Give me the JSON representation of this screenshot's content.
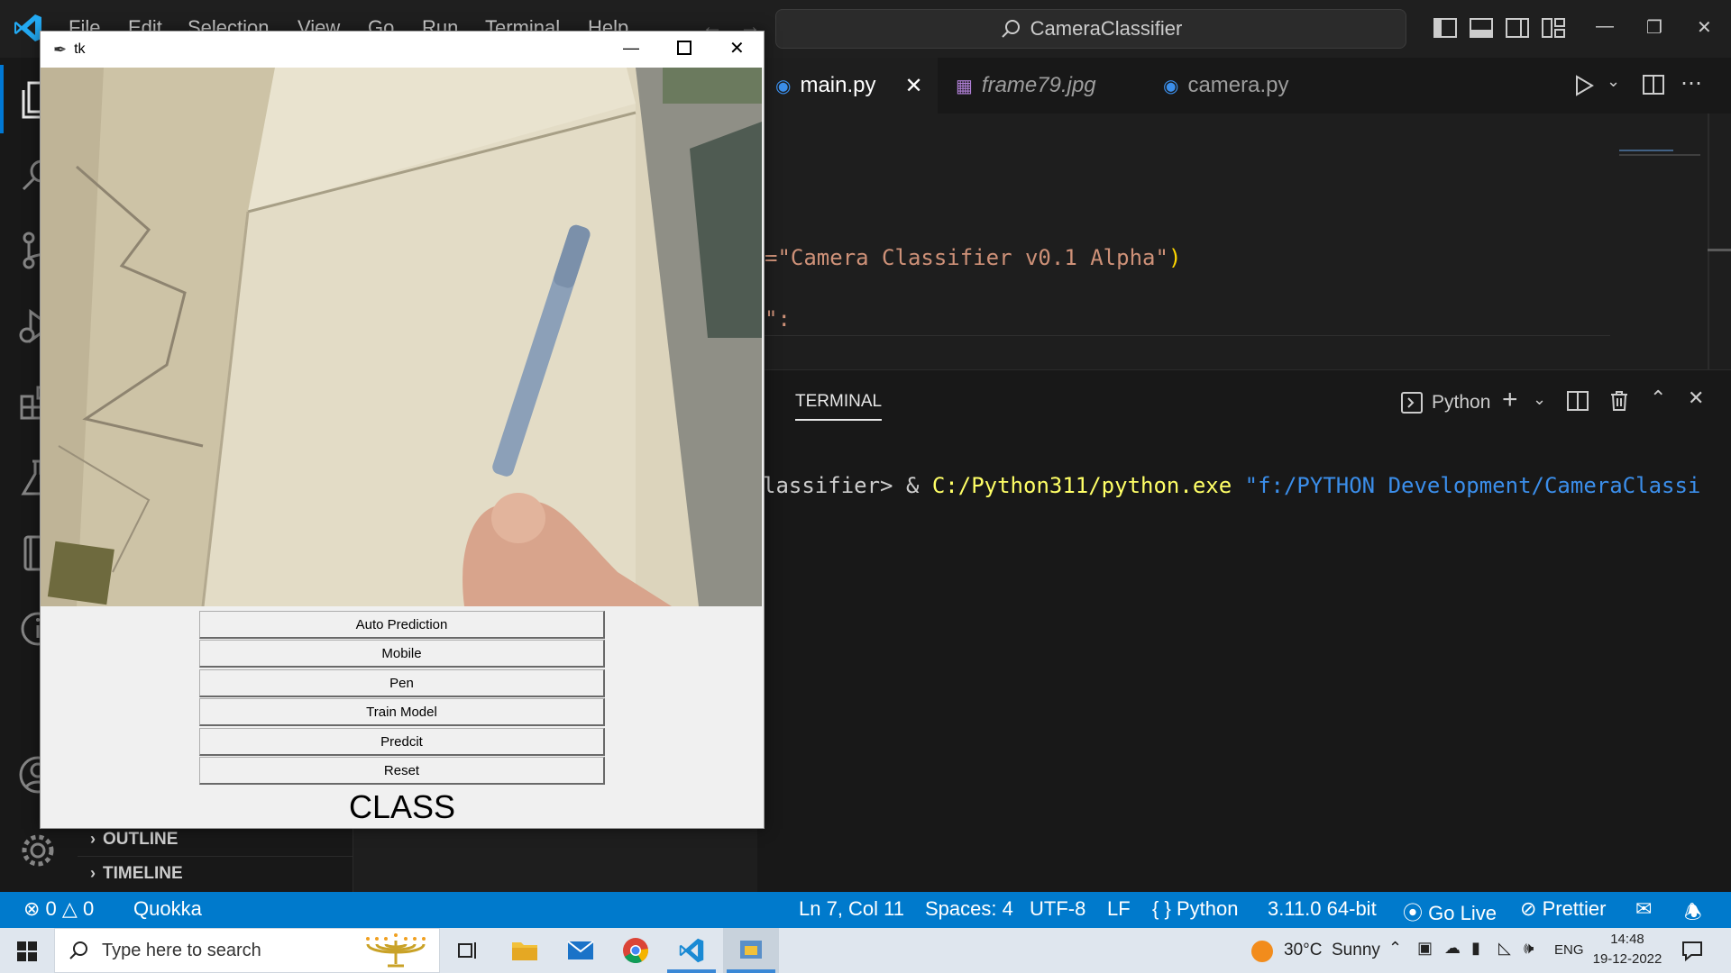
{
  "vscode": {
    "menu": [
      "File",
      "Edit",
      "Selection",
      "View",
      "Go",
      "Run",
      "Terminal",
      "Help"
    ],
    "search_text": "CameraClassifier",
    "tabs": [
      {
        "label": "main.py",
        "active": true,
        "italic": false,
        "icon": "python-icon"
      },
      {
        "label": "frame79.jpg",
        "active": false,
        "italic": true,
        "icon": "image-icon"
      },
      {
        "label": "camera.py",
        "active": false,
        "italic": false,
        "icon": "python-icon"
      }
    ],
    "code": {
      "line1_str": "=\"Camera Classifier v0.1 Alpha\"",
      "line1_paren": ")",
      "line2": "\":"
    },
    "sidebar": {
      "outline": "OUTLINE",
      "timeline": "TIMELINE"
    },
    "panel": {
      "tab": "TERMINAL",
      "shell": "Python",
      "terminal_prompt": "lassifier> & ",
      "terminal_exe": "C:/Python311/python.exe",
      "terminal_arg": " \"f:/PYTHON Development/CameraClassi"
    },
    "status": {
      "errors": "0",
      "warnings": "0",
      "quokka": "Quokka",
      "position": "Ln 7, Col 11",
      "spaces": "Spaces: 4",
      "encoding": "UTF-8",
      "eol": "LF",
      "language": "Python",
      "interpreter": "3.11.0 64-bit",
      "golive": "Go Live",
      "prettier": "Prettier"
    }
  },
  "tk": {
    "title": "tk",
    "buttons": [
      "Auto Prediction",
      "Mobile",
      "Pen",
      "Train Model",
      "Predcit",
      "Reset"
    ],
    "class_label": "CLASS"
  },
  "taskbar": {
    "search_placeholder": "Type here to search",
    "weather": "30°C  Sunny",
    "lang": "ENG",
    "time": "14:48",
    "date": "19-12-2022"
  },
  "colors": {
    "accent": "#007acc",
    "string": "#ce9178",
    "func": "#dcdcaa",
    "terminal_exe": "#ffff66",
    "terminal_arg": "#3b8eea"
  }
}
